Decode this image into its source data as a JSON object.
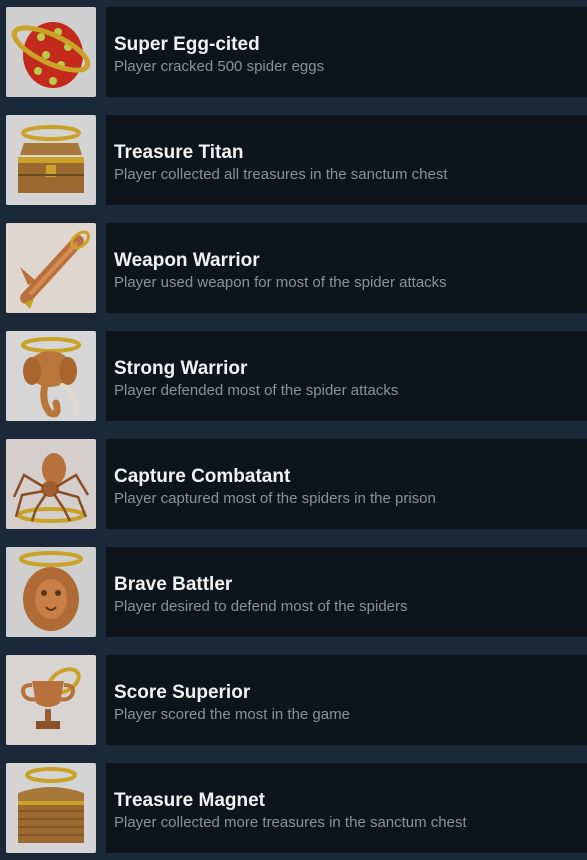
{
  "achievements": [
    {
      "title": "Super Egg-cited",
      "description": "Player cracked 500 spider eggs",
      "icon": "egg-icon"
    },
    {
      "title": "Treasure Titan",
      "description": "Player collected all treasures in the sanctum chest",
      "icon": "open-chest-icon"
    },
    {
      "title": "Weapon Warrior",
      "description": "Player used weapon for most of the spider attacks",
      "icon": "sword-icon"
    },
    {
      "title": "Strong Warrior",
      "description": "Player defended most of the spider attacks",
      "icon": "elephant-icon"
    },
    {
      "title": "Capture Combatant",
      "description": "Player captured most of the spiders in the prison",
      "icon": "spider-icon"
    },
    {
      "title": "Brave Battler",
      "description": "Player desired to defend most of the spiders",
      "icon": "lion-icon"
    },
    {
      "title": "Score Superior",
      "description": "Player scored the most in the game",
      "icon": "trophy-icon"
    },
    {
      "title": "Treasure Magnet",
      "description": "Player collected more treasures in the sanctum chest",
      "icon": "closed-chest-icon"
    }
  ],
  "colors": {
    "page_background": "#1b2838",
    "panel_background": "#0e141b",
    "title_text": "#f2f2f2",
    "description_text": "#8a9199",
    "gold": "#c9a227",
    "copper": "#b8703d"
  }
}
